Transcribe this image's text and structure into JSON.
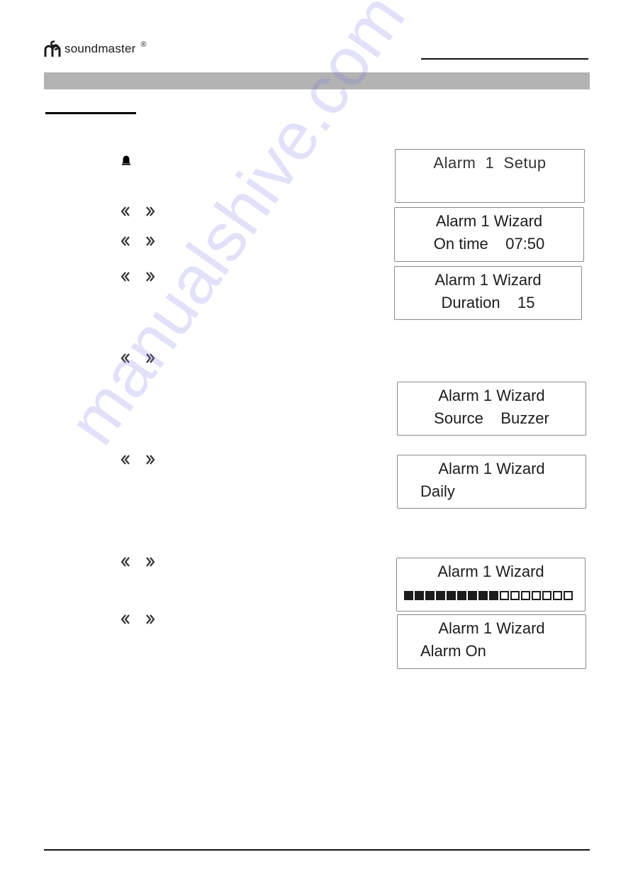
{
  "header": {
    "brand": "soundmaster",
    "registered_mark": "®"
  },
  "icons": {
    "bell": "bell-icon",
    "prev": "chevron-double-left-icon",
    "next": "chevron-double-right-icon"
  },
  "displays": [
    {
      "line1": "Alarm  1  Setup",
      "line2": ""
    },
    {
      "line1": "Alarm 1 Wizard",
      "line2": "On time    07:50"
    },
    {
      "line1": "Alarm 1 Wizard",
      "line2": "Duration    15"
    },
    {
      "line1": "Alarm 1 Wizard",
      "line2": "Source    Buzzer"
    },
    {
      "line1": "Alarm 1 Wizard",
      "line2": "Daily"
    },
    {
      "line1": "Alarm 1 Wizard",
      "volume": {
        "filled": 9,
        "total": 16
      }
    },
    {
      "line1": "Alarm 1 Wizard",
      "line2": "Alarm On"
    }
  ],
  "watermark": "manualshive.com",
  "colors": {
    "section_bar": "#b3b3b3",
    "watermark": "#7878e6"
  }
}
